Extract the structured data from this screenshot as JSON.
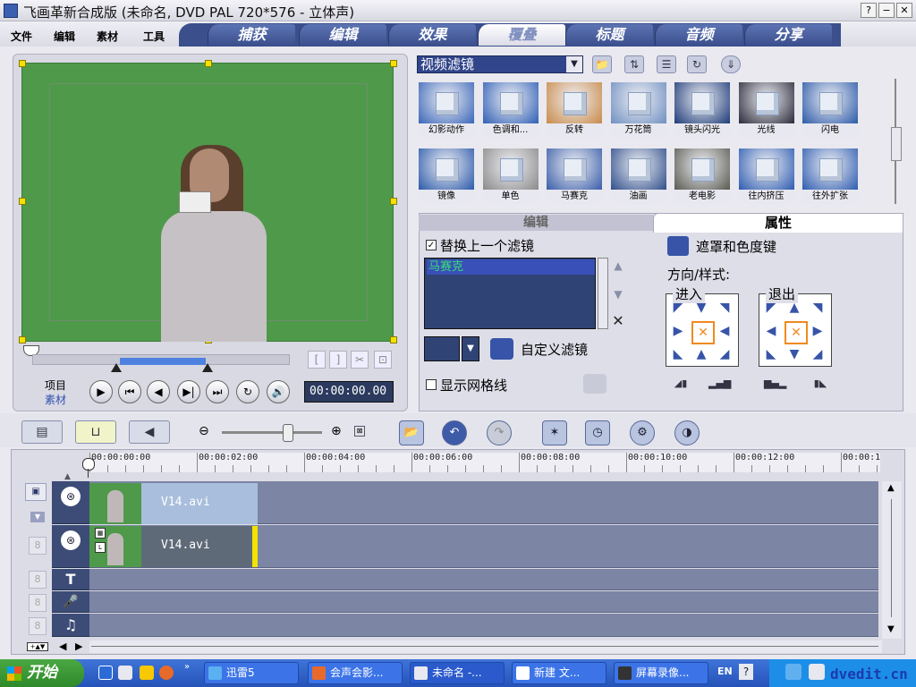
{
  "window": {
    "title": "飞画革新合成版 (未命名, DVD PAL 720*576 - 立体声)",
    "buttons": [
      "?",
      "−",
      "✕"
    ]
  },
  "menu": [
    "文件",
    "编辑",
    "素材",
    "工具"
  ],
  "tabs": [
    {
      "label": "捕获",
      "active": false
    },
    {
      "label": "编辑",
      "active": false
    },
    {
      "label": "效果",
      "active": false
    },
    {
      "label": "覆叠",
      "active": true
    },
    {
      "label": "标题",
      "active": false
    },
    {
      "label": "音频",
      "active": false
    },
    {
      "label": "分享",
      "active": false
    }
  ],
  "preview": {
    "mode_labels": [
      "项目",
      "素材"
    ],
    "trim_in": "[",
    "trim_out": "]",
    "cut": "✂",
    "fit": "⊡",
    "playback": [
      "▶",
      "⏮",
      "◀",
      "▶|",
      "⏭",
      "↻",
      "🔊"
    ],
    "timecode": "00:00:00.00"
  },
  "library": {
    "category": "视频滤镜",
    "tool_icons": [
      "folder-icon",
      "sort-icon",
      "options-icon",
      "refresh-icon",
      "expand-icon"
    ],
    "filters": [
      {
        "name": "幻影动作",
        "tint": "#3a66b8"
      },
      {
        "name": "色调和...",
        "tint": "#2f5fb5"
      },
      {
        "name": "反转",
        "tint": "#c88a4a"
      },
      {
        "name": "万花筒",
        "tint": "#6f8fc0"
      },
      {
        "name": "镜头闪光",
        "tint": "#1d3b78"
      },
      {
        "name": "光线",
        "tint": "#2a2a3a"
      },
      {
        "name": "闪电",
        "tint": "#2b5aa8"
      },
      {
        "name": "镜像",
        "tint": "#2c5aaa"
      },
      {
        "name": "单色",
        "tint": "#8a8a8a"
      },
      {
        "name": "马赛克",
        "tint": "#3a5ea8"
      },
      {
        "name": "油画",
        "tint": "#2f4f8a"
      },
      {
        "name": "老电影",
        "tint": "#5a5a52"
      },
      {
        "name": "往内挤压",
        "tint": "#2e5cb0"
      },
      {
        "name": "往外扩张",
        "tint": "#2e5cb0"
      }
    ]
  },
  "panel": {
    "tab_edit": "编辑",
    "tab_attr": "属性",
    "replace_filter_label": "替换上一个滤镜",
    "replace_filter_checked": true,
    "applied_filters": [
      "马赛克"
    ],
    "custom_filter_label": "自定义滤镜",
    "show_grid_label": "显示网格线",
    "show_grid_checked": false,
    "mask_label": "遮罩和色度键",
    "direction_label": "方向/样式:",
    "enter_label": "进入",
    "exit_label": "退出"
  },
  "timeline": {
    "ruler_labels": [
      "00:00:00:00",
      "00:00:02:00",
      "00:00:04:00",
      "00:00:06:00",
      "00:00:08:00",
      "00:00:10:00",
      "00:00:12:00",
      "00:00:1"
    ],
    "clips": [
      {
        "name": "V14.avi",
        "track": "video"
      },
      {
        "name": "V14.avi",
        "track": "overlay"
      }
    ],
    "track_icons": [
      "video-track-icon",
      "overlay-track-icon",
      "title-track-icon",
      "voice-track-icon",
      "music-track-icon"
    ]
  },
  "taskbar": {
    "start_label": "开始",
    "tasks": [
      "迅雷5",
      "会声会影...",
      "未命名 -...",
      "新建 文...",
      "屏幕录像..."
    ],
    "lang": "EN",
    "watermark": "dvedit.cn"
  },
  "colors": {
    "tab_blue": "#3b4f8d",
    "green_screen": "#4e9a4a",
    "selection_blue": "#3850b8",
    "filter_text_green": "#38e070",
    "clip_yellow": "#f3e200",
    "taskbar_blue": "#2553b8"
  }
}
